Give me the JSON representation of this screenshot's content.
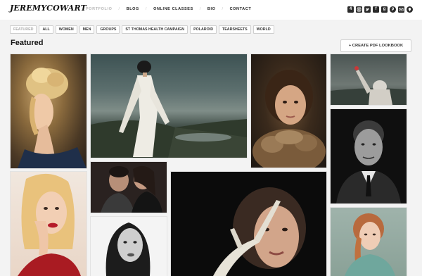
{
  "header": {
    "logo": "JEREMYCOWART",
    "nav": [
      {
        "label": "PORTFOLIO",
        "muted": true
      },
      {
        "label": "BLOG"
      },
      {
        "label": "ONLINE CLASSES"
      },
      {
        "label": "BIO"
      },
      {
        "label": "CONTACT"
      }
    ],
    "social_icons": [
      "4",
      "instagram-icon",
      "twitter-icon",
      "facebook-icon",
      "google-plus-icon",
      "pinterest-icon",
      "email-icon",
      "location-pin-icon"
    ]
  },
  "filters": [
    "FEATURED",
    "ALL",
    "WOMEN",
    "MEN",
    "GROUPS",
    "ST THOMAS HEALTH CAMPAIGN",
    "POLAROID",
    "TEARSHEETS",
    "WORLD"
  ],
  "page": {
    "title": "Featured",
    "pdf_button": "+ CREATE PDF LOOKBOOK"
  },
  "photos": [
    {
      "name": "blonde-updo-portrait"
    },
    {
      "name": "white-coat-cliff-scene"
    },
    {
      "name": "girl-feather-collar-portrait"
    },
    {
      "name": "hooded-figure-landscape"
    },
    {
      "name": "man-in-suit-portrait"
    },
    {
      "name": "couple-laughing-portrait"
    },
    {
      "name": "blonde-red-lips-portrait"
    },
    {
      "name": "woman-antler-portrait"
    },
    {
      "name": "brunette-bw-portrait"
    },
    {
      "name": "redhead-braid-portrait"
    }
  ]
}
